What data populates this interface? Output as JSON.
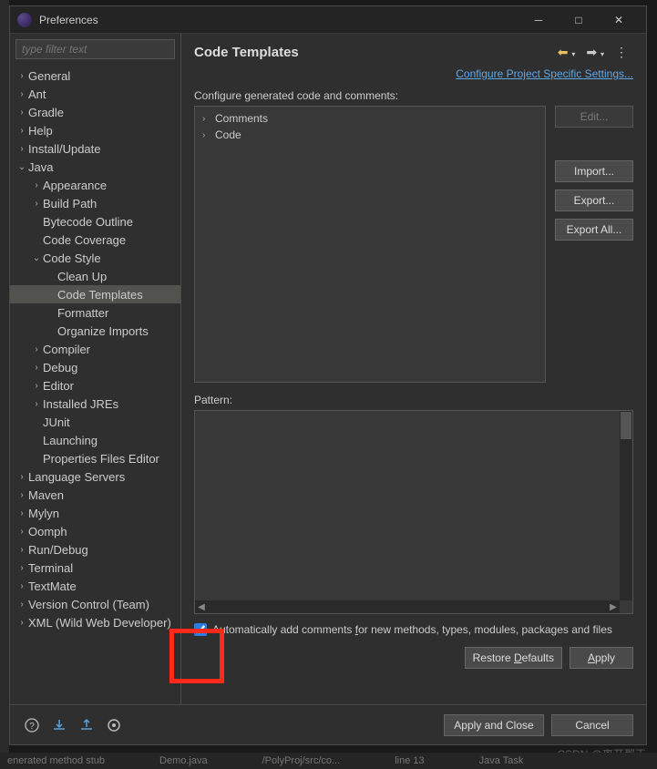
{
  "window": {
    "title": "Preferences"
  },
  "filter": {
    "placeholder": "type filter text"
  },
  "tree": [
    {
      "label": "General",
      "level": 0,
      "arrow": ">"
    },
    {
      "label": "Ant",
      "level": 0,
      "arrow": ">"
    },
    {
      "label": "Gradle",
      "level": 0,
      "arrow": ">"
    },
    {
      "label": "Help",
      "level": 0,
      "arrow": ">"
    },
    {
      "label": "Install/Update",
      "level": 0,
      "arrow": ">"
    },
    {
      "label": "Java",
      "level": 0,
      "arrow": "v"
    },
    {
      "label": "Appearance",
      "level": 1,
      "arrow": ">"
    },
    {
      "label": "Build Path",
      "level": 1,
      "arrow": ">"
    },
    {
      "label": "Bytecode Outline",
      "level": 1,
      "arrow": ""
    },
    {
      "label": "Code Coverage",
      "level": 1,
      "arrow": ""
    },
    {
      "label": "Code Style",
      "level": 1,
      "arrow": "v"
    },
    {
      "label": "Clean Up",
      "level": 2,
      "arrow": ""
    },
    {
      "label": "Code Templates",
      "level": 2,
      "arrow": "",
      "selected": true
    },
    {
      "label": "Formatter",
      "level": 2,
      "arrow": ""
    },
    {
      "label": "Organize Imports",
      "level": 2,
      "arrow": ""
    },
    {
      "label": "Compiler",
      "level": 1,
      "arrow": ">"
    },
    {
      "label": "Debug",
      "level": 1,
      "arrow": ">"
    },
    {
      "label": "Editor",
      "level": 1,
      "arrow": ">"
    },
    {
      "label": "Installed JREs",
      "level": 1,
      "arrow": ">"
    },
    {
      "label": "JUnit",
      "level": 1,
      "arrow": ""
    },
    {
      "label": "Launching",
      "level": 1,
      "arrow": ""
    },
    {
      "label": "Properties Files Editor",
      "level": 1,
      "arrow": ""
    },
    {
      "label": "Language Servers",
      "level": 0,
      "arrow": ">"
    },
    {
      "label": "Maven",
      "level": 0,
      "arrow": ">"
    },
    {
      "label": "Mylyn",
      "level": 0,
      "arrow": ">"
    },
    {
      "label": "Oomph",
      "level": 0,
      "arrow": ">"
    },
    {
      "label": "Run/Debug",
      "level": 0,
      "arrow": ">"
    },
    {
      "label": "Terminal",
      "level": 0,
      "arrow": ">"
    },
    {
      "label": "TextMate",
      "level": 0,
      "arrow": ">"
    },
    {
      "label": "Version Control (Team)",
      "level": 0,
      "arrow": ">"
    },
    {
      "label": "XML (Wild Web Developer)",
      "level": 0,
      "arrow": ">"
    }
  ],
  "pane": {
    "title": "Code Templates",
    "link": "Configure Project Specific Settings...",
    "section_label": "Configure generated code and comments:",
    "tree_items": [
      {
        "label": "Comments"
      },
      {
        "label": "Code"
      }
    ],
    "buttons": {
      "edit": "Edit...",
      "import": "Import...",
      "export": "Export...",
      "export_all": "Export All..."
    },
    "pattern_label": "Pattern:",
    "checkbox_label_pre": "Automatically add comments ",
    "checkbox_label_u": "f",
    "checkbox_label_post": "or new methods, types, modules, packages and files",
    "restore_pre": "Restore ",
    "restore_u": "D",
    "restore_post": "efaults",
    "apply_u": "A",
    "apply_post": "pply"
  },
  "footer": {
    "apply_close": "Apply and Close",
    "cancel": "Cancel"
  },
  "watermark": "CSDN @离开那天",
  "status": {
    "a": "enerated method stub",
    "b": "Demo.java",
    "c": "/PolyProj/src/co...",
    "d": "line 13",
    "e": "Java Task"
  }
}
